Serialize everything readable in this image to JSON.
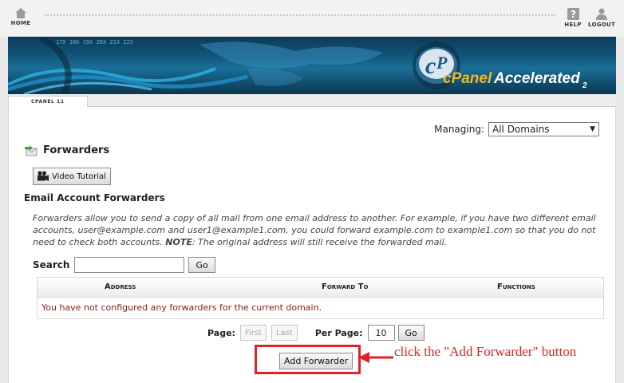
{
  "topbar": {
    "home_label": "HOME",
    "help_label": "HELP",
    "logout_label": "LOGOUT"
  },
  "banner": {
    "logo_text_c": "c",
    "logo_text_p": "P",
    "brand": "cPanel",
    "brand_suffix": "Accelerated",
    "version_sub": "2"
  },
  "strip": {
    "tab_label": "CPANEL 11"
  },
  "managing": {
    "label": "Managing:",
    "selected": "All Domains"
  },
  "page": {
    "title": "Forwarders",
    "video_button": "Video Tutorial",
    "section_heading": "Email Account Forwarders",
    "description_main": "Forwarders allow you to send a copy of all mail from one email address to another. For example, if you have two different email accounts, user@example.com and user1@example1.com, you could forward example.com to example1.com so that you do not need to check both accounts. ",
    "description_note_label": "NOTE",
    "description_note": ": The original address will still receive the forwarded mail."
  },
  "search": {
    "label": "Search",
    "value": "",
    "go": "Go"
  },
  "table": {
    "columns": [
      "Address",
      "Forward To",
      "Functions"
    ],
    "empty_message": "You have not configured any forwarders for the current domain."
  },
  "pager": {
    "page_label": "Page:",
    "first": "First",
    "last": "Last",
    "per_page_label": "Per Page:",
    "per_page_value": "10",
    "go": "Go"
  },
  "add_forwarder": {
    "label": "Add Forwarder"
  },
  "annotation": {
    "text": "click the \"Add Forwarder\" button",
    "color": "#e0222a"
  },
  "colors": {
    "accent_red": "#e0222a",
    "error_text": "#8b1a1a",
    "banner_blue": "#11577c"
  }
}
